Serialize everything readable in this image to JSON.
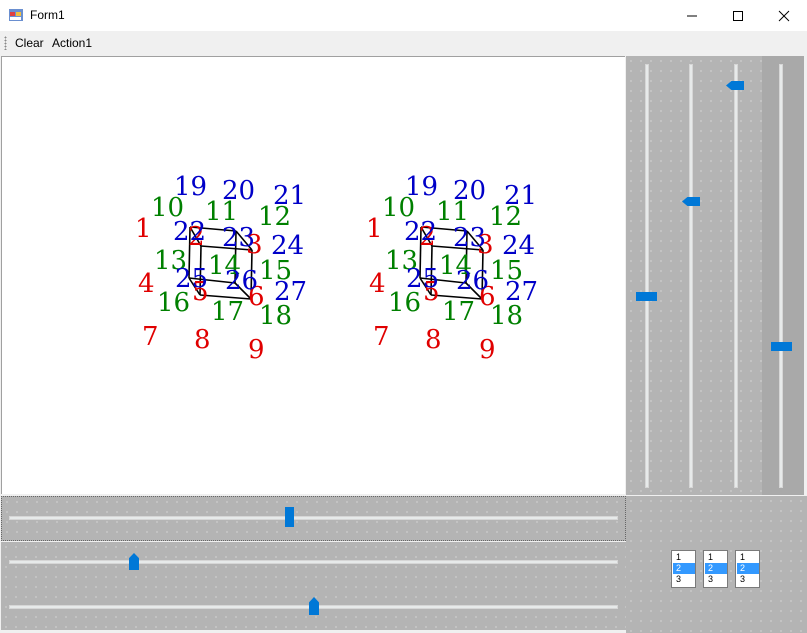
{
  "window": {
    "title": "Form1",
    "minimize_icon": "minimize-icon",
    "maximize_icon": "maximize-icon",
    "close_icon": "close-icon"
  },
  "menu": {
    "items": [
      "Clear",
      "Action1"
    ]
  },
  "canvas": {
    "figure_count": 2,
    "labels": [
      {
        "t": "1",
        "c": "red"
      },
      {
        "t": "2",
        "c": "red"
      },
      {
        "t": "3",
        "c": "red"
      },
      {
        "t": "4",
        "c": "red"
      },
      {
        "t": "5",
        "c": "red"
      },
      {
        "t": "6",
        "c": "red"
      },
      {
        "t": "7",
        "c": "red"
      },
      {
        "t": "8",
        "c": "red"
      },
      {
        "t": "9",
        "c": "red"
      },
      {
        "t": "10",
        "c": "green"
      },
      {
        "t": "11",
        "c": "green"
      },
      {
        "t": "12",
        "c": "green"
      },
      {
        "t": "13",
        "c": "green"
      },
      {
        "t": "14",
        "c": "green"
      },
      {
        "t": "15",
        "c": "green"
      },
      {
        "t": "16",
        "c": "green"
      },
      {
        "t": "17",
        "c": "green"
      },
      {
        "t": "18",
        "c": "green"
      },
      {
        "t": "19",
        "c": "blue"
      },
      {
        "t": "20",
        "c": "blue"
      },
      {
        "t": "21",
        "c": "blue"
      },
      {
        "t": "22",
        "c": "blue"
      },
      {
        "t": "23",
        "c": "blue"
      },
      {
        "t": "24",
        "c": "blue"
      },
      {
        "t": "25",
        "c": "blue"
      },
      {
        "t": "26",
        "c": "blue"
      },
      {
        "t": "27",
        "c": "blue"
      }
    ]
  },
  "sliders": {
    "vertical": [
      {
        "name": "vslider-1",
        "value_fraction": 0.55
      },
      {
        "name": "vslider-2",
        "value_fraction": 0.32
      },
      {
        "name": "vslider-3",
        "value_fraction": 0.04
      },
      {
        "name": "vslider-4",
        "value_fraction": 0.67
      }
    ],
    "horizontal": [
      {
        "name": "hslider-1",
        "value_fraction": 0.46
      },
      {
        "name": "hslider-2",
        "value_fraction": 0.2
      },
      {
        "name": "hslider-3",
        "value_fraction": 0.5
      }
    ]
  },
  "listboxes": [
    {
      "items": [
        "1",
        "2",
        "3"
      ],
      "selected": 1
    },
    {
      "items": [
        "1",
        "2",
        "3"
      ],
      "selected": 1
    },
    {
      "items": [
        "1",
        "2",
        "3"
      ],
      "selected": 1
    }
  ],
  "colors": {
    "red": "#e00000",
    "green": "#008000",
    "blue": "#0000c8",
    "accent": "#0078d7"
  }
}
